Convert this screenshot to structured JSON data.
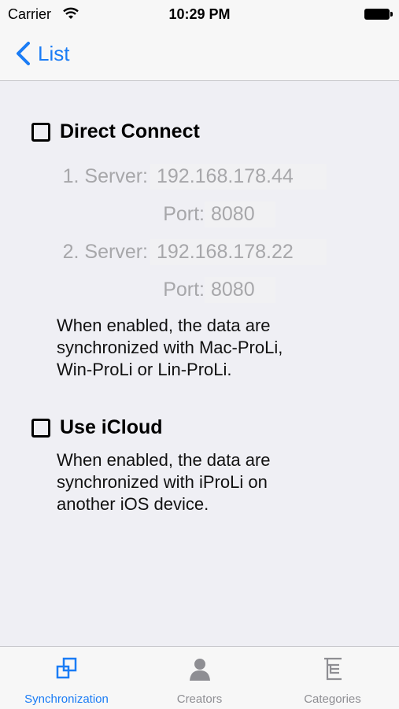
{
  "status_bar": {
    "carrier": "Carrier",
    "time": "10:29 PM"
  },
  "nav": {
    "back_label": "List"
  },
  "direct_connect": {
    "label": "Direct Connect",
    "checked": false,
    "server1": {
      "server_label": "1. Server:",
      "server_value": "192.168.178.44",
      "port_label": "Port:",
      "port_value": "8080"
    },
    "server2": {
      "server_label": "2. Server:",
      "server_value": "192.168.178.22",
      "port_label": "Port:",
      "port_value": "8080"
    },
    "description_lines": [
      "When enabled, the data are",
      "synchronized with Mac-ProLi,",
      "Win-ProLi or Lin-ProLi."
    ]
  },
  "icloud": {
    "label": "Use iCloud",
    "checked": false,
    "description_lines": [
      "When enabled, the data are",
      "synchronized with iProLi on",
      "another iOS device."
    ]
  },
  "tabs": [
    {
      "label": "Synchronization",
      "icon": "sync-icon",
      "active": true
    },
    {
      "label": "Creators",
      "icon": "person-icon",
      "active": false
    },
    {
      "label": "Categories",
      "icon": "categories-icon",
      "active": false
    }
  ],
  "colors": {
    "accent": "#1a7cf5",
    "inactive": "#8e8e93",
    "disabled_text": "#a7a7aa"
  }
}
